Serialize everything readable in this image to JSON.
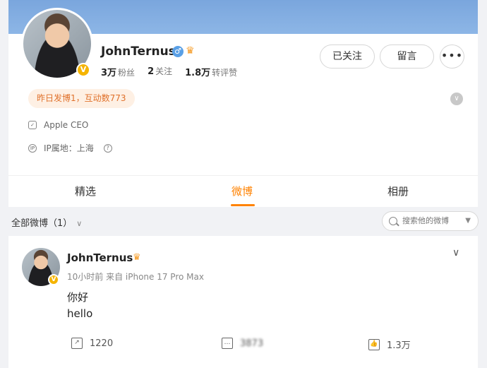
{
  "profile": {
    "name": "JohnTernus",
    "gender_symbol": "♂",
    "stats": [
      {
        "value": "3万",
        "label": "粉丝"
      },
      {
        "value": "2",
        "label": "关注"
      },
      {
        "value": "1.8万",
        "label": "转评赞"
      }
    ],
    "buttons": {
      "follow": "已关注",
      "message": "留言",
      "more": "•••"
    },
    "activity": "昨日发博1，互动数773",
    "bio": "Apple CEO",
    "ip": "IP属地：上海",
    "ip_help": "?"
  },
  "tabs": [
    {
      "label": "精选"
    },
    {
      "label": "微博"
    },
    {
      "label": "相册"
    }
  ],
  "filter": {
    "label": "全部微博（1）",
    "chevron": "∨"
  },
  "search": {
    "placeholder": "搜索他的微博",
    "caret": "▼"
  },
  "post": {
    "name": "JohnTernus",
    "meta": "10小时前 来自 iPhone 17 Pro Max",
    "line1": "你好",
    "line2": "hello",
    "more": "∨",
    "actions": {
      "repost": "1220",
      "comment": "3873",
      "like": "1.3万"
    }
  },
  "colors": {
    "accent": "#ff8200",
    "badge": "#f5b400",
    "banner": "#8db6e6"
  },
  "icons": [
    "verified-badge-icon",
    "gender-male-icon",
    "crown-icon",
    "shield-icon",
    "ip-icon",
    "help-icon",
    "search-icon",
    "repost-icon",
    "comment-icon",
    "like-icon"
  ]
}
